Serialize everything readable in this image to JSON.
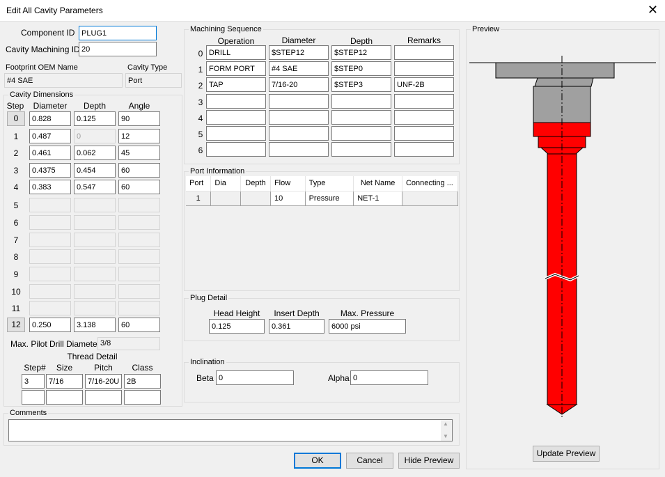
{
  "window": {
    "title": "Edit All Cavity Parameters"
  },
  "component": {
    "component_id_label": "Component ID",
    "component_id_value": "PLUG1",
    "cavity_machining_id_label": "Cavity Machining ID",
    "cavity_machining_id_value": "20",
    "footprint_label": "Footprint OEM Name",
    "footprint_value": "#4 SAE",
    "cavity_type_label": "Cavity Type",
    "cavity_type_value": "Port"
  },
  "cavity_dimensions": {
    "legend": "Cavity Dimensions",
    "headers": [
      "Step",
      "Diameter",
      "Depth",
      "Angle"
    ],
    "rows": [
      {
        "step": "0",
        "diameter": "0.828",
        "depth": "0.125",
        "angle": "90"
      },
      {
        "step": "1",
        "diameter": "0.487",
        "depth": "0",
        "angle": "12"
      },
      {
        "step": "2",
        "diameter": "0.461",
        "depth": "0.062",
        "angle": "45"
      },
      {
        "step": "3",
        "diameter": "0.4375",
        "depth": "0.454",
        "angle": "60"
      },
      {
        "step": "4",
        "diameter": "0.383",
        "depth": "0.547",
        "angle": "60"
      },
      {
        "step": "5",
        "diameter": "",
        "depth": "",
        "angle": ""
      },
      {
        "step": "6",
        "diameter": "",
        "depth": "",
        "angle": ""
      },
      {
        "step": "7",
        "diameter": "",
        "depth": "",
        "angle": ""
      },
      {
        "step": "8",
        "diameter": "",
        "depth": "",
        "angle": ""
      },
      {
        "step": "9",
        "diameter": "",
        "depth": "",
        "angle": ""
      },
      {
        "step": "10",
        "diameter": "",
        "depth": "",
        "angle": ""
      },
      {
        "step": "11",
        "diameter": "",
        "depth": "",
        "angle": ""
      },
      {
        "step": "12",
        "diameter": "0.250",
        "depth": "3.138",
        "angle": "60"
      }
    ],
    "max_pilot_label": "Max. Pilot Drill Diameter",
    "max_pilot_value": "3/8"
  },
  "thread_detail": {
    "title": "Thread Detail",
    "headers": [
      "Step#",
      "Size",
      "Pitch",
      "Class"
    ],
    "rows": [
      {
        "step": "3",
        "size": "7/16",
        "pitch": "7/16-20U",
        "class": "2B"
      },
      {
        "step": "",
        "size": "",
        "pitch": "",
        "class": ""
      }
    ]
  },
  "machining_sequence": {
    "legend": "Machining Sequence",
    "headers": [
      "Operation",
      "Diameter",
      "Depth",
      "Remarks"
    ],
    "rows": [
      {
        "idx": "0",
        "operation": "DRILL",
        "diameter": "$STEP12",
        "depth": "$STEP12",
        "remarks": ""
      },
      {
        "idx": "1",
        "operation": "FORM PORT",
        "diameter": "#4 SAE",
        "depth": "$STEP0",
        "remarks": ""
      },
      {
        "idx": "2",
        "operation": "TAP",
        "diameter": "7/16-20",
        "depth": "$STEP3",
        "remarks": "UNF-2B"
      },
      {
        "idx": "3",
        "operation": "",
        "diameter": "",
        "depth": "",
        "remarks": ""
      },
      {
        "idx": "4",
        "operation": "",
        "diameter": "",
        "depth": "",
        "remarks": ""
      },
      {
        "idx": "5",
        "operation": "",
        "diameter": "",
        "depth": "",
        "remarks": ""
      },
      {
        "idx": "6",
        "operation": "",
        "diameter": "",
        "depth": "",
        "remarks": ""
      }
    ]
  },
  "port_information": {
    "legend": "Port Information",
    "headers": [
      "Port",
      "Dia",
      "Depth",
      "Flow",
      "Type",
      "Net Name",
      "Connecting ..."
    ],
    "rows": [
      {
        "port": "1",
        "dia": "",
        "depth": "",
        "flow": "10",
        "type": "Pressure",
        "net_name": "NET-1",
        "connecting": ""
      }
    ]
  },
  "plug_detail": {
    "legend": "Plug Detail",
    "head_height_label": "Head Height",
    "head_height_value": "0.125",
    "insert_depth_label": "Insert Depth",
    "insert_depth_value": "0.361",
    "max_pressure_label": "Max. Pressure",
    "max_pressure_value": "6000 psi"
  },
  "inclination": {
    "legend": "Inclination",
    "beta_label": "Beta",
    "beta_value": "0",
    "alpha_label": "Alpha",
    "alpha_value": "0"
  },
  "comments": {
    "legend": "Comments",
    "value": ""
  },
  "buttons": {
    "ok": "OK",
    "cancel": "Cancel",
    "hide_preview": "Hide Preview",
    "update_preview": "Update Preview"
  },
  "preview": {
    "legend": "Preview",
    "colors": {
      "red": "#ff0000",
      "gray": "#a0a0a0",
      "outline": "#000000"
    }
  }
}
